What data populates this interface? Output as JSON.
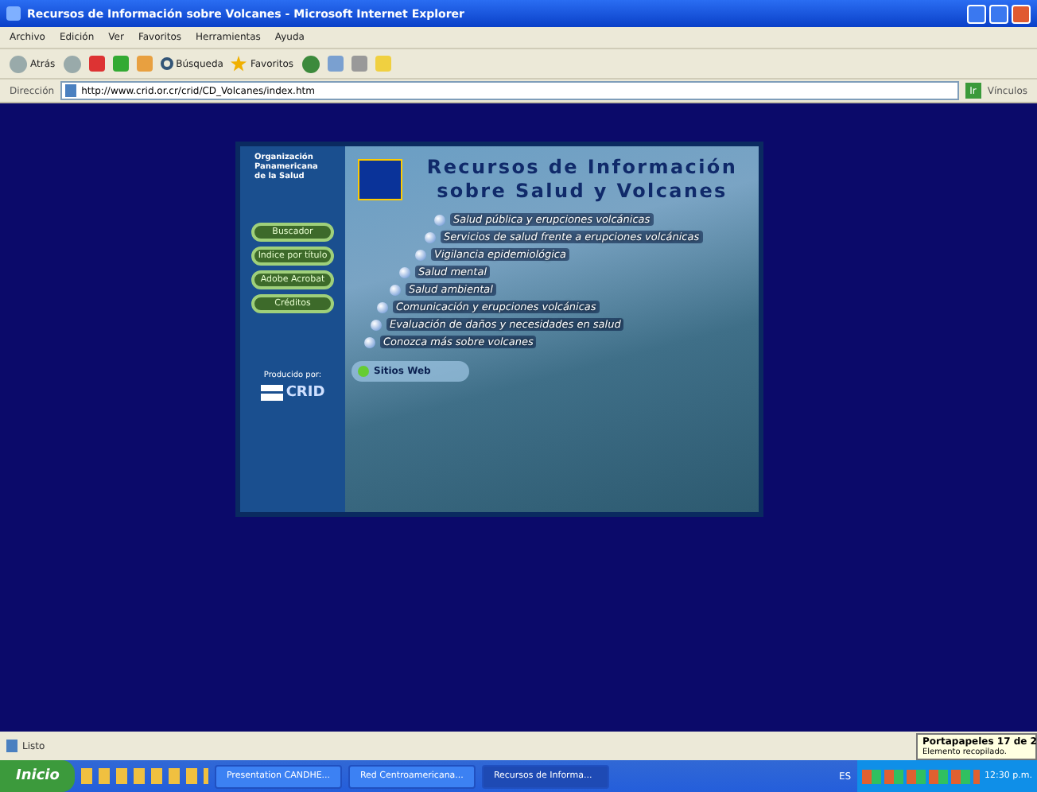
{
  "window": {
    "title": "Recursos de Información sobre Volcanes - Microsoft Internet Explorer"
  },
  "menu": [
    "Archivo",
    "Edición",
    "Ver",
    "Favoritos",
    "Herramientas",
    "Ayuda"
  ],
  "toolbar": {
    "back": "Atrás",
    "search": "Búsqueda",
    "favorites": "Favoritos"
  },
  "address": {
    "label": "Dirección",
    "value": "http://www.crid.or.cr/crid/CD_Volcanes/index.htm",
    "go": "Ir",
    "links": "Vínculos"
  },
  "page": {
    "org": "Organización Panamericana de la Salud",
    "title": [
      "Recursos de Información",
      "sobre Salud y Volcanes"
    ],
    "buttons": [
      "Buscador",
      "Indice por título",
      "Adobe Acrobat",
      "Créditos"
    ],
    "produced_by": "Producido por:",
    "crid": "CRID",
    "links": [
      {
        "label": "Salud pública y erupciones volcánicas",
        "kind": "topic"
      },
      {
        "label": "Servicios de salud frente a erupciones volcánicas",
        "kind": "topic"
      },
      {
        "label": "Vigilancia epidemiológica",
        "kind": "topic"
      },
      {
        "label": "Salud mental",
        "kind": "topic"
      },
      {
        "label": "Salud ambiental",
        "kind": "topic"
      },
      {
        "label": "Comunicación y erupciones volcánicas",
        "kind": "topic"
      },
      {
        "label": "Evaluación de daños y necesidades en salud",
        "kind": "topic"
      },
      {
        "label": "Conozca más sobre volcanes",
        "kind": "topic"
      },
      {
        "label": "Sitios Web",
        "kind": "web"
      }
    ]
  },
  "status_bar": "Listo",
  "balloon": {
    "title": "Portapapeles 17 de 2",
    "text": "Elemento recopilado."
  },
  "taskbar": {
    "start": "Inicio",
    "tasks": [
      {
        "label": "Presentation CANDHE...",
        "selected": false
      },
      {
        "label": "Red Centroamericana...",
        "selected": false
      },
      {
        "label": "Recursos de Informa...",
        "selected": true
      }
    ],
    "lang": "ES",
    "clock": "12:30 p.m."
  }
}
